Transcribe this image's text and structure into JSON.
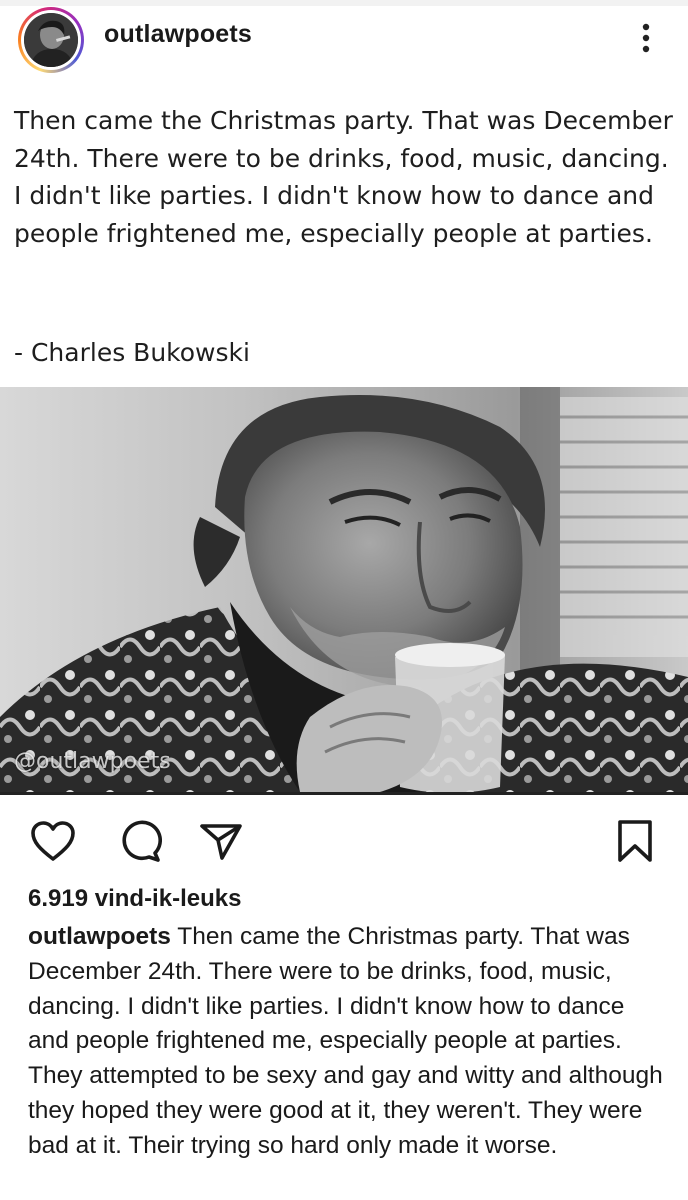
{
  "post": {
    "username": "outlawpoets",
    "quote_text": "Then came the Christmas party. That was December 24th. There were to be drinks, food, music, dancing. I didn't like parties. I didn't know how to dance and people frightened me, especially people at parties.",
    "quote_author": "- Charles Bukowski",
    "watermark": "@outlawpoets",
    "likes": "6.919 vind-ik-leuks",
    "caption_user": "outlawpoets",
    "caption_text": "Then came the Christmas party. That was December 24th. There were to be drinks, food, music, dancing. I didn't like parties. I didn't know how to dance and people frightened me, especially people at parties. They attempted to be sexy and gay and witty and although they hoped they were good at it, they weren't. They were bad at it. Their trying so hard only made it worse."
  },
  "icons": {
    "more": "more-vertical-icon",
    "like": "heart-icon",
    "comment": "comment-icon",
    "share": "paper-plane-icon",
    "save": "bookmark-icon"
  },
  "colors": {
    "text": "#1a1a1a",
    "ring_gradient": [
      "#feda75",
      "#fa7e1e",
      "#d62976",
      "#962fbf",
      "#4f5bd5"
    ]
  }
}
